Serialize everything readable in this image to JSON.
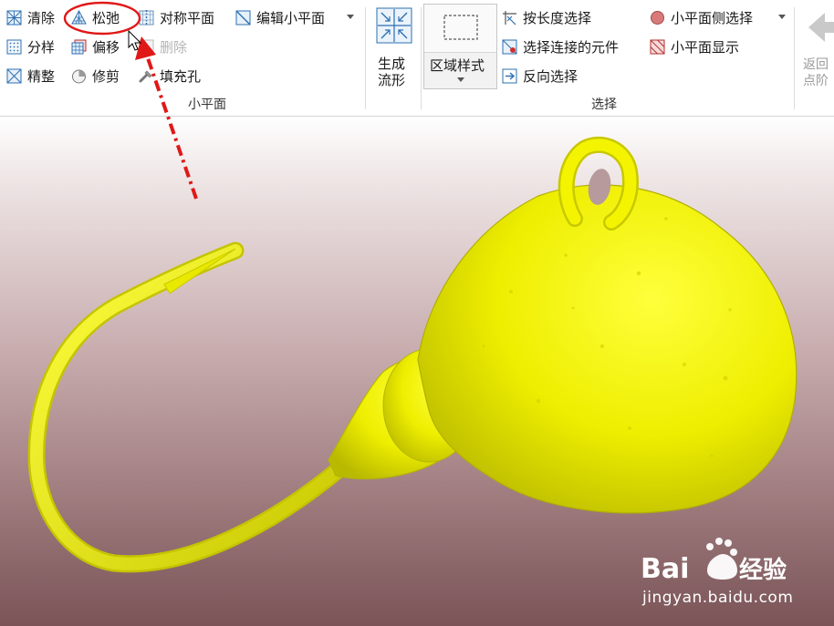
{
  "ribbon": {
    "facet_group": {
      "label": "小平面",
      "items": {
        "clean": "清除",
        "relax": "松弛",
        "symmetry_plane": "对称平面",
        "edit_facet": "编辑小平面",
        "sample": "分样",
        "offset": "偏移",
        "delete": "删除",
        "refine": "精整",
        "trim": "修剪",
        "fill_hole": "填充孔"
      }
    },
    "generate_shape": {
      "line1": "生成",
      "line2": "流形"
    },
    "region_style": {
      "label": "区域样式"
    },
    "select_group": {
      "label": "选择",
      "items": {
        "by_length": "按长度选择",
        "select_connected": "选择连接的元件",
        "reverse_select": "反向选择",
        "facet_side_select": "小平面侧选择",
        "facet_display": "小平面显示"
      }
    },
    "back": {
      "line1": "返回",
      "line2": "点阶"
    }
  },
  "watermark": {
    "brand": "Bai",
    "brand_cn": "经验",
    "url": "jingyan.baidu.com"
  },
  "colors": {
    "model": "#f0f000",
    "annotation": "#e01818",
    "ribbon_bg": "#ffffff",
    "icon_blue": "#2e6fb0"
  }
}
